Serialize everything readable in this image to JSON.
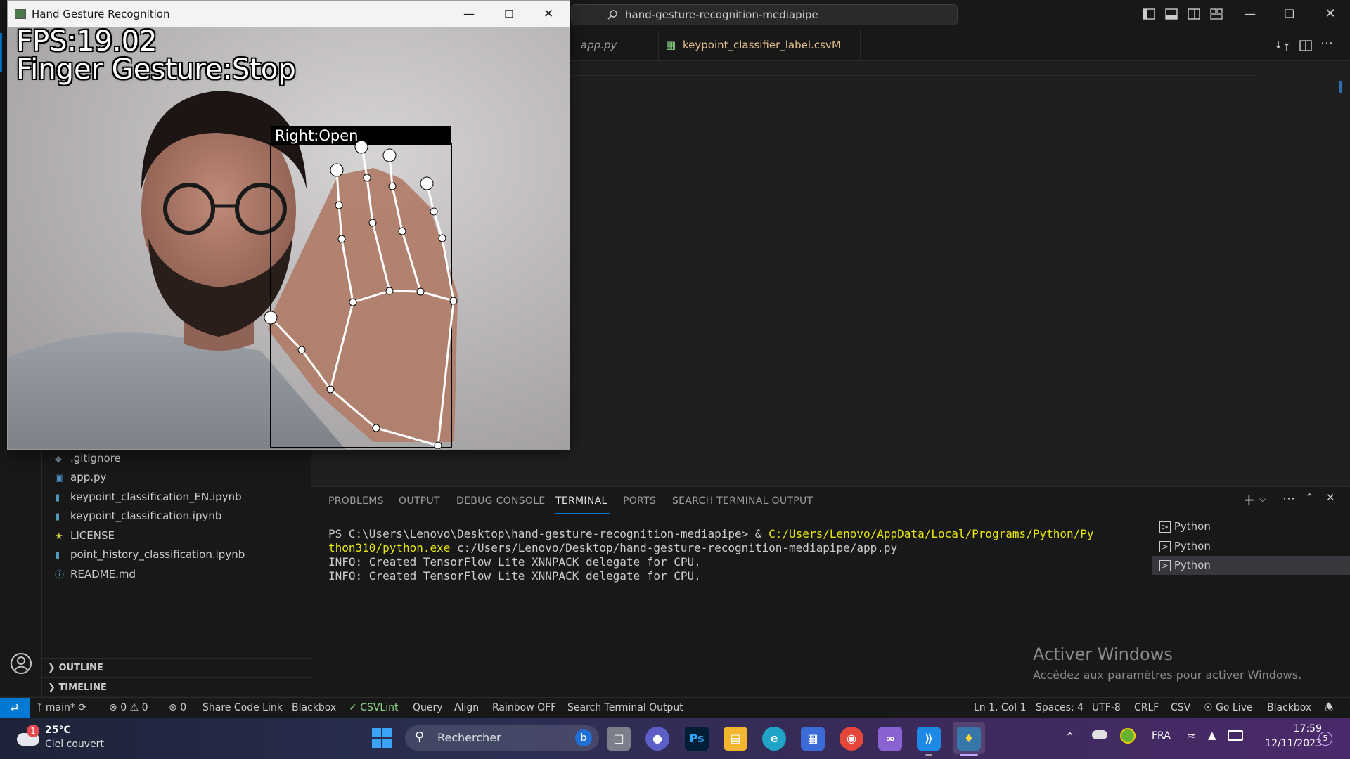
{
  "vscode": {
    "search_text": "hand-gesture-recognition-mediapipe",
    "tabs": [
      {
        "label": "app.py"
      },
      {
        "label": "keypoint_classifier_label.csv",
        "badge": "M"
      }
    ],
    "explorer_files": [
      {
        "icon": "gitignore-icon",
        "label": ".gitignore"
      },
      {
        "icon": "python-file-icon",
        "label": "app.py"
      },
      {
        "icon": "notebook-icon",
        "label": "keypoint_classification_EN.ipynb"
      },
      {
        "icon": "notebook-icon",
        "label": "keypoint_classification.ipynb"
      },
      {
        "icon": "license-icon",
        "label": "LICENSE"
      },
      {
        "icon": "notebook-icon",
        "label": "point_history_classification.ipynb"
      },
      {
        "icon": "info-icon",
        "label": "README.md"
      }
    ],
    "sections": {
      "outline": "OUTLINE",
      "timeline": "TIMELINE"
    },
    "panel_tabs": [
      "PROBLEMS",
      "OUTPUT",
      "DEBUG CONSOLE",
      "TERMINAL",
      "PORTS",
      "SEARCH TERMINAL OUTPUT"
    ],
    "active_panel_tab": "TERMINAL",
    "terminal": {
      "prompt": "PS C:\\Users\\Lenovo\\Desktop\\hand-gesture-recognition-mediapipe> & ",
      "exe_part1": "C:/Users/Lenovo/AppData/Local/Programs/Python/Py",
      "exe_part2": "thon310/python.exe",
      "args": " c:/Users/Lenovo/Desktop/hand-gesture-recognition-mediapipe/app.py",
      "info1": "INFO: Created TensorFlow Lite XNNPACK delegate for CPU.",
      "info2": "INFO: Created TensorFlow Lite XNNPACK delegate for CPU."
    },
    "terminal_list": [
      "Python",
      "Python",
      "Python"
    ],
    "activation": {
      "title": "Activer Windows",
      "subtitle": "Accédez aux paramètres pour activer Windows."
    },
    "status_left": {
      "branch": "main*",
      "errors": "0",
      "warnings": "0",
      "ports": "0",
      "share": "Share Code Link",
      "blackbox": "Blackbox",
      "csvlint": "CSVLint",
      "query": "Query",
      "align": "Align",
      "rainbow": "Rainbow OFF",
      "search_terminal": "Search Terminal Output"
    },
    "status_right": {
      "position": "Ln 1, Col 1",
      "spaces": "Spaces: 4",
      "encoding": "UTF-8",
      "eol": "CRLF",
      "language": "CSV",
      "golive": "Go Live",
      "blackbox": "Blackbox"
    }
  },
  "cv_window": {
    "title": "Hand Gesture Recognition",
    "fps": "FPS:19.02",
    "finger_gesture": "Finger Gesture:Stop",
    "hand_label": "Right:Open"
  },
  "taskbar": {
    "weather_temp": "25°C",
    "weather_desc": "Ciel couvert",
    "weather_badge": "1",
    "search_placeholder": "Rechercher",
    "language": "FRA",
    "time": "17:59",
    "date": "12/11/2023",
    "notif_count": "5"
  }
}
